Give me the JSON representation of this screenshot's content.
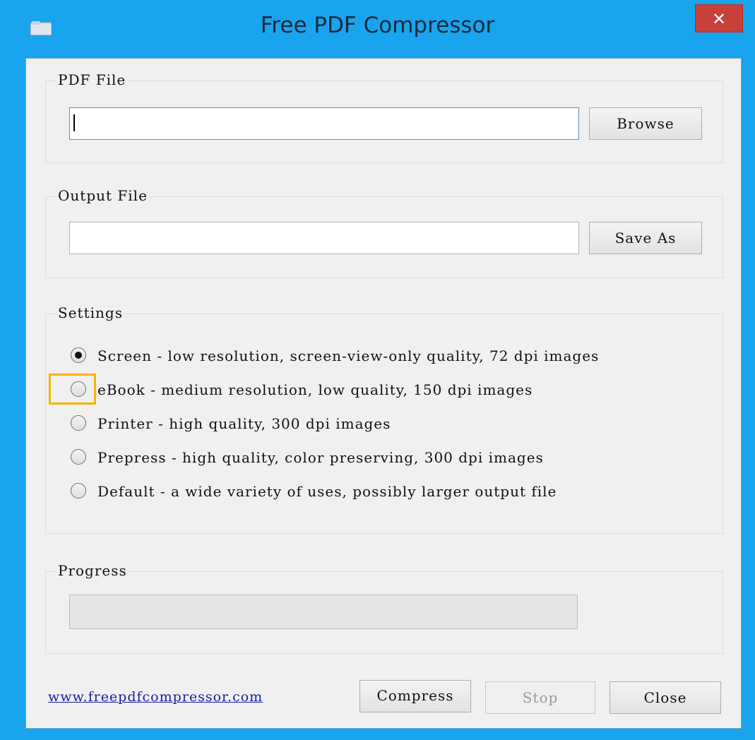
{
  "window": {
    "title": "Free PDF Compressor",
    "close_glyph": "✕"
  },
  "pdf_file": {
    "legend": "PDF File",
    "value": "",
    "browse_label": "Browse"
  },
  "output_file": {
    "legend": "Output File",
    "value": "",
    "save_as_label": "Save As"
  },
  "settings": {
    "legend": "Settings",
    "options": [
      {
        "label": "Screen - low resolution, screen-view-only quality, 72 dpi images",
        "selected": true
      },
      {
        "label": "eBook - medium resolution, low quality, 150 dpi images",
        "selected": false
      },
      {
        "label": "Printer - high quality, 300 dpi images",
        "selected": false
      },
      {
        "label": "Prepress - high quality, color preserving, 300 dpi images",
        "selected": false
      },
      {
        "label": "Default - a wide variety of uses, possibly larger output file",
        "selected": false
      }
    ]
  },
  "progress": {
    "legend": "Progress",
    "value": 0
  },
  "footer": {
    "link_text": "www.freepdfcompressor.com",
    "compress_label": "Compress",
    "stop_label": "Stop",
    "close_label": "Close"
  },
  "colors": {
    "frame": "#19a4ee",
    "close_button": "#c8403a",
    "highlight": "#f4b400"
  }
}
